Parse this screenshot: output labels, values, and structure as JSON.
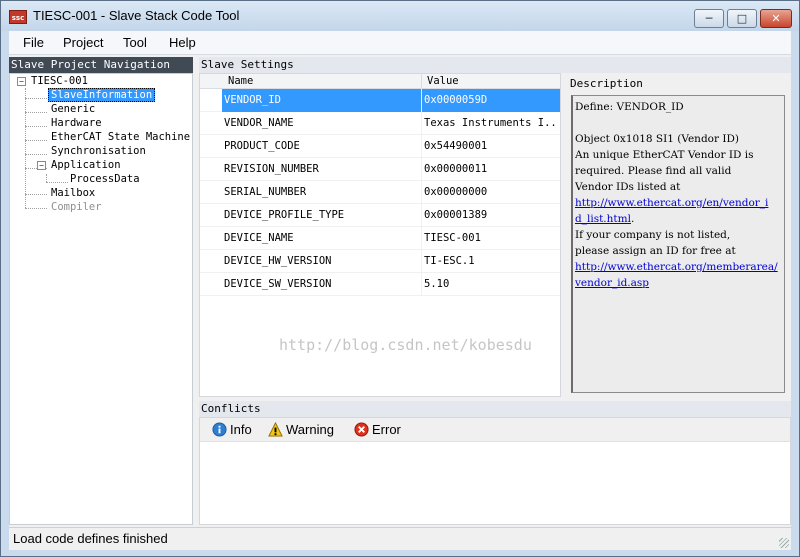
{
  "window": {
    "title": "TIESC-001 - Slave Stack Code Tool",
    "app_icon": "ssc"
  },
  "window_buttons": {
    "minimize": "minimize-icon",
    "maximize": "maximize-icon",
    "close": "close-icon"
  },
  "menu": {
    "items": [
      "File",
      "Project",
      "Tool",
      "Help"
    ]
  },
  "navigation": {
    "title": "Slave Project Navigation",
    "nodes": [
      {
        "label": "TIESC-001"
      },
      {
        "label": "SlaveInformation",
        "selected": true
      },
      {
        "label": "Generic"
      },
      {
        "label": "Hardware"
      },
      {
        "label": "EtherCAT State Machine"
      },
      {
        "label": "Synchronisation"
      },
      {
        "label": "Application"
      },
      {
        "label": "ProcessData"
      },
      {
        "label": "Mailbox"
      },
      {
        "label": "Compiler",
        "disabled": true
      }
    ]
  },
  "settings": {
    "title": "Slave Settings",
    "columns": {
      "name": "Name",
      "value": "Value"
    },
    "rows": [
      {
        "name": "VENDOR_ID",
        "value": "0x0000059D",
        "selected": true
      },
      {
        "name": "VENDOR_NAME",
        "value": "Texas Instruments I..."
      },
      {
        "name": "PRODUCT_CODE",
        "value": "0x54490001"
      },
      {
        "name": "REVISION_NUMBER",
        "value": "0x00000011"
      },
      {
        "name": "SERIAL_NUMBER",
        "value": "0x00000000"
      },
      {
        "name": "DEVICE_PROFILE_TYPE",
        "value": "0x00001389"
      },
      {
        "name": "DEVICE_NAME",
        "value": "TIESC-001"
      },
      {
        "name": "DEVICE_HW_VERSION",
        "value": "TI-ESC.1"
      },
      {
        "name": "DEVICE_SW_VERSION",
        "value": "5.10"
      }
    ],
    "watermark": "http://blog.csdn.net/kobesdu"
  },
  "description": {
    "label": "Description",
    "lines": [
      "Define: VENDOR_ID",
      "",
      "Object 0x1018 SI1 (Vendor ID)",
      "An unique EtherCAT Vendor ID is",
      "required. Please find all valid",
      "Vendor IDs listed at",
      "http://www.ethercat.org/en/vendor_i",
      "d_list.html.",
      "If your company is not listed,",
      "please assign an ID for free at",
      "http://www.ethercat.org/memberarea/",
      "vendor_id.asp"
    ]
  },
  "conflicts": {
    "title": "Conflicts",
    "filters": [
      {
        "label": "Info",
        "icon": "info-icon"
      },
      {
        "label": "Warning",
        "icon": "warning-icon"
      },
      {
        "label": "Error",
        "icon": "error-icon"
      }
    ]
  },
  "status": {
    "text": "Load code defines finished"
  }
}
